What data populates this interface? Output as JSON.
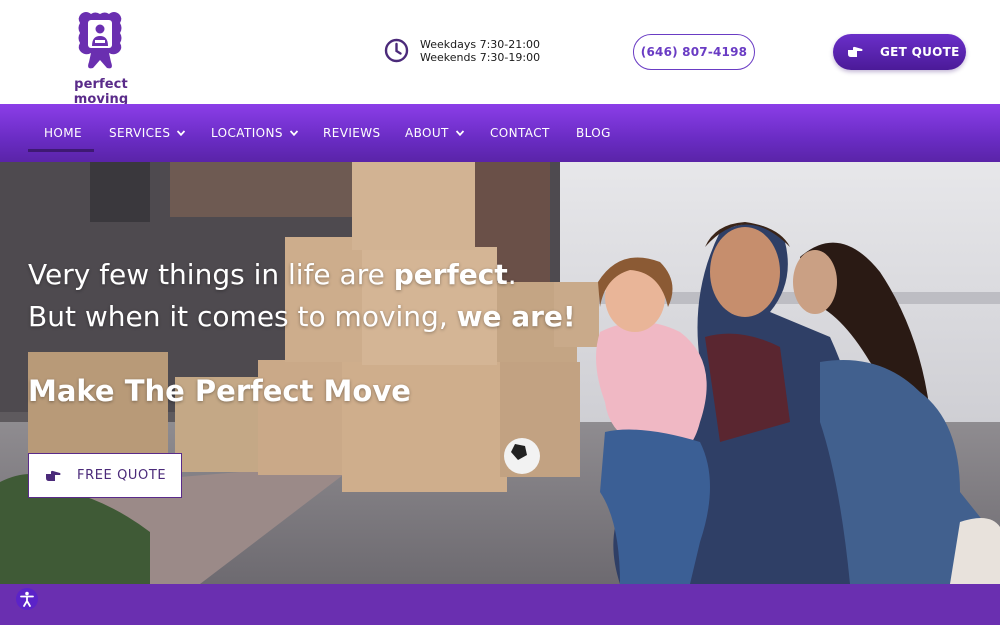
{
  "header": {
    "logo": {
      "text": "perfect moving"
    },
    "hours": {
      "weekdays": "Weekdays 7:30-21:00",
      "weekends": "Weekends 7:30-19:00"
    },
    "phone": "(646) 807-4198",
    "cta": "GET QUOTE"
  },
  "nav": {
    "items": [
      {
        "label": "HOME",
        "active": true
      },
      {
        "label": "SERVICES",
        "dropdown": true
      },
      {
        "label": "LOCATIONS",
        "dropdown": true
      },
      {
        "label": "REVIEWS"
      },
      {
        "label": "ABOUT",
        "dropdown": true
      },
      {
        "label": "CONTACT"
      },
      {
        "label": "BLOG"
      }
    ]
  },
  "hero": {
    "line1_a": "Very few things in life are ",
    "line1_b": "perfect",
    "line1_c": ".",
    "line2_a": "But when it comes to moving, ",
    "line2_b": "we are!",
    "subheading": "Make The Perfect Move",
    "button": "FREE QUOTE"
  },
  "colors": {
    "brand_purple": "#6a2fc9",
    "nav_top": "#8b3ee8",
    "nav_bottom": "#5a24a8",
    "band": "#6a2fb0"
  },
  "icons": {
    "clock": "clock-icon",
    "cta": "pointing-hand-icon",
    "accessibility": "accessibility-icon"
  }
}
